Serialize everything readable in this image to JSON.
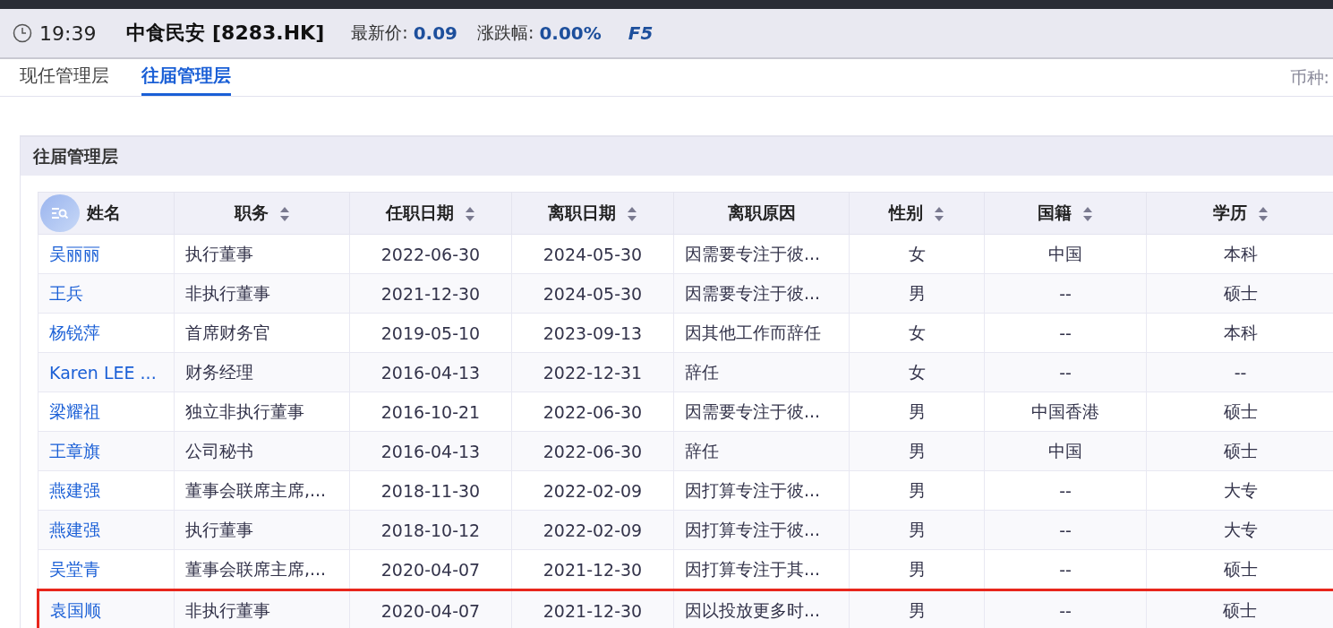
{
  "header": {
    "time": "19:39",
    "stock": "中食民安 [8283.HK]",
    "price_label": "最新价:",
    "price": "0.09",
    "change_label": "涨跌幅:",
    "change": "0.00%",
    "refresh_key": "F5"
  },
  "tabs": [
    {
      "label": "现任管理层",
      "selected": false
    },
    {
      "label": "往届管理层",
      "selected": true
    }
  ],
  "currency_label": "币种:",
  "section": {
    "title": "往届管理层"
  },
  "table": {
    "columns": [
      {
        "label": "姓名",
        "sortable": false
      },
      {
        "label": "职务",
        "sortable": true
      },
      {
        "label": "任职日期",
        "sortable": true
      },
      {
        "label": "离职日期",
        "sortable": true
      },
      {
        "label": "离职原因",
        "sortable": false
      },
      {
        "label": "性别",
        "sortable": true
      },
      {
        "label": "国籍",
        "sortable": true
      },
      {
        "label": "学历",
        "sortable": true
      }
    ],
    "rows": [
      {
        "highlighted": false,
        "cells": [
          "吴丽丽",
          "执行董事",
          "2022-06-30",
          "2024-05-30",
          "因需要专注于彼...",
          "女",
          "中国",
          "本科"
        ]
      },
      {
        "highlighted": false,
        "cells": [
          "王兵",
          "非执行董事",
          "2021-12-30",
          "2024-05-30",
          "因需要专注于彼...",
          "男",
          "--",
          "硕士"
        ]
      },
      {
        "highlighted": false,
        "cells": [
          "杨锐萍",
          "首席财务官",
          "2019-05-10",
          "2023-09-13",
          "因其他工作而辞任",
          "女",
          "--",
          "本科"
        ]
      },
      {
        "highlighted": false,
        "cells": [
          "Karen LEE ...",
          "财务经理",
          "2016-04-13",
          "2022-12-31",
          "辞任",
          "女",
          "--",
          "--"
        ]
      },
      {
        "highlighted": false,
        "cells": [
          "梁耀祖",
          "独立非执行董事",
          "2016-10-21",
          "2022-06-30",
          "因需要专注于彼...",
          "男",
          "中国香港",
          "硕士"
        ]
      },
      {
        "highlighted": false,
        "cells": [
          "王章旗",
          "公司秘书",
          "2016-04-13",
          "2022-06-30",
          "辞任",
          "男",
          "中国",
          "硕士"
        ]
      },
      {
        "highlighted": false,
        "cells": [
          "燕建强",
          "董事会联席主席,...",
          "2018-11-30",
          "2022-02-09",
          "因打算专注于彼...",
          "男",
          "--",
          "大专"
        ]
      },
      {
        "highlighted": false,
        "cells": [
          "燕建强",
          "执行董事",
          "2018-10-12",
          "2022-02-09",
          "因打算专注于彼...",
          "男",
          "--",
          "大专"
        ]
      },
      {
        "highlighted": false,
        "cells": [
          "吴堂青",
          "董事会联席主席,...",
          "2020-04-07",
          "2021-12-30",
          "因打算专注于其...",
          "男",
          "--",
          "硕士"
        ]
      },
      {
        "highlighted": true,
        "cells": [
          "袁国顺",
          "非执行董事",
          "2020-04-07",
          "2021-12-30",
          "因以投放更多时...",
          "男",
          "--",
          "硕士"
        ]
      }
    ]
  }
}
